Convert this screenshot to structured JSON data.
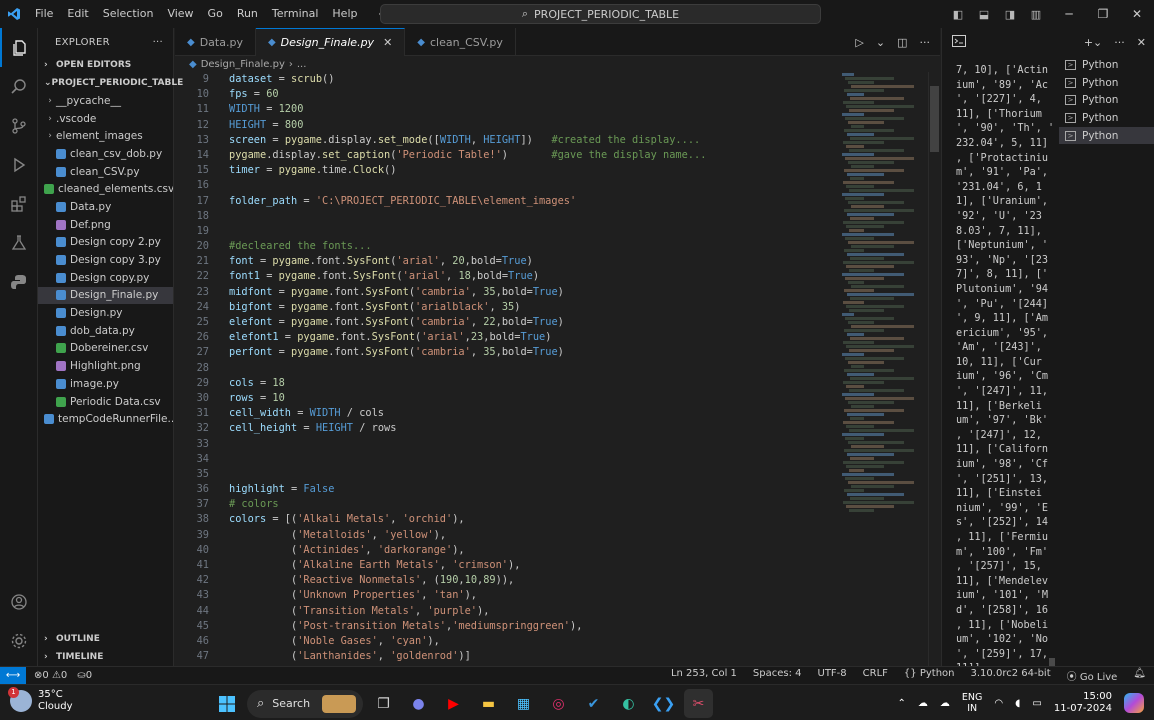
{
  "titlebar": {
    "menu": [
      "File",
      "Edit",
      "Selection",
      "View",
      "Go",
      "Run",
      "Terminal",
      "Help"
    ],
    "search": "PROJECT_PERIODIC_TABLE"
  },
  "sidebar": {
    "title": "EXPLORER",
    "open_editors": "OPEN EDITORS",
    "project": "PROJECT_PERIODIC_TABLE",
    "items": [
      {
        "label": "__pycache__",
        "kind": "folder"
      },
      {
        "label": ".vscode",
        "kind": "folder"
      },
      {
        "label": "element_images",
        "kind": "folder"
      },
      {
        "label": "clean_csv_dob.py",
        "kind": "py"
      },
      {
        "label": "clean_CSV.py",
        "kind": "py"
      },
      {
        "label": "cleaned_elements.csv",
        "kind": "csv"
      },
      {
        "label": "Data.py",
        "kind": "py"
      },
      {
        "label": "Def.png",
        "kind": "png"
      },
      {
        "label": "Design copy 2.py",
        "kind": "py"
      },
      {
        "label": "Design copy 3.py",
        "kind": "py"
      },
      {
        "label": "Design copy.py",
        "kind": "py"
      },
      {
        "label": "Design_Finale.py",
        "kind": "py",
        "selected": true
      },
      {
        "label": "Design.py",
        "kind": "py"
      },
      {
        "label": "dob_data.py",
        "kind": "py"
      },
      {
        "label": "Dobereiner.csv",
        "kind": "csv"
      },
      {
        "label": "Highlight.png",
        "kind": "png"
      },
      {
        "label": "image.py",
        "kind": "py"
      },
      {
        "label": "Periodic Data.csv",
        "kind": "csv"
      },
      {
        "label": "tempCodeRunnerFile....",
        "kind": "py"
      }
    ],
    "outline": "OUTLINE",
    "timeline": "TIMELINE"
  },
  "tabs": [
    {
      "label": "Data.py"
    },
    {
      "label": "Design_Finale.py",
      "active": true
    },
    {
      "label": "clean_CSV.py"
    }
  ],
  "breadcrumb": {
    "file": "Design_Finale.py",
    "rest": "..."
  },
  "code_lines": [
    {
      "n": "9",
      "text": "dataset = scrub()"
    },
    {
      "n": "10",
      "text": "fps = 60"
    },
    {
      "n": "11",
      "text": "WIDTH = 1200"
    },
    {
      "n": "12",
      "text": "HEIGHT = 800"
    },
    {
      "n": "13",
      "text": "screen = pygame.display.set_mode([WIDTH, HEIGHT])   #created the display...."
    },
    {
      "n": "14",
      "text": "pygame.display.set_caption('Periodic Table!')       #gave the display name..."
    },
    {
      "n": "15",
      "text": "timer = pygame.time.Clock()"
    },
    {
      "n": "16",
      "text": ""
    },
    {
      "n": "17",
      "text": "folder_path = 'C:\\PROJECT_PERIODIC_TABLE\\element_images'"
    },
    {
      "n": "18",
      "text": ""
    },
    {
      "n": "19",
      "text": ""
    },
    {
      "n": "20",
      "text": "#decleared the fonts..."
    },
    {
      "n": "21",
      "text": "font = pygame.font.SysFont('arial', 20,bold=True)"
    },
    {
      "n": "22",
      "text": "font1 = pygame.font.SysFont('arial', 18,bold=True)"
    },
    {
      "n": "23",
      "text": "midfont = pygame.font.SysFont('cambria', 35,bold=True)"
    },
    {
      "n": "24",
      "text": "bigfont = pygame.font.SysFont('arialblack', 35)"
    },
    {
      "n": "25",
      "text": "elefont = pygame.font.SysFont('cambria', 22,bold=True)"
    },
    {
      "n": "26",
      "text": "elefont1 = pygame.font.SysFont('arial',23,bold=True)"
    },
    {
      "n": "27",
      "text": "perfont = pygame.font.SysFont('cambria', 35,bold=True)"
    },
    {
      "n": "28",
      "text": ""
    },
    {
      "n": "29",
      "text": "cols = 18"
    },
    {
      "n": "30",
      "text": "rows = 10"
    },
    {
      "n": "31",
      "text": "cell_width = WIDTH / cols"
    },
    {
      "n": "32",
      "text": "cell_height = HEIGHT / rows"
    },
    {
      "n": "33",
      "text": ""
    },
    {
      "n": "34",
      "text": ""
    },
    {
      "n": "35",
      "text": ""
    },
    {
      "n": "36",
      "text": "highlight = False"
    },
    {
      "n": "37",
      "text": "# colors"
    },
    {
      "n": "38",
      "text": "colors = [('Alkali Metals', 'orchid'),"
    },
    {
      "n": "39",
      "text": "          ('Metalloids', 'yellow'),"
    },
    {
      "n": "40",
      "text": "          ('Actinides', 'darkorange'),"
    },
    {
      "n": "41",
      "text": "          ('Alkaline Earth Metals', 'crimson'),"
    },
    {
      "n": "42",
      "text": "          ('Reactive Nonmetals', (190,10,89)),"
    },
    {
      "n": "43",
      "text": "          ('Unknown Properties', 'tan'),"
    },
    {
      "n": "44",
      "text": "          ('Transition Metals', 'purple'),"
    },
    {
      "n": "45",
      "text": "          ('Post-transition Metals','mediumspringgreen'),"
    },
    {
      "n": "46",
      "text": "          ('Noble Gases', 'cyan'),"
    },
    {
      "n": "47",
      "text": "          ('Lanthanides', 'goldenrod')]"
    }
  ],
  "terminal": {
    "output": "7, 10], ['Actin\nium', '89', 'Ac\n', '[227]', 4,\n11], ['Thorium\n', '90', 'Th', '\n232.04', 5, 11]\n, ['Protactiniu\nm', '91', 'Pa',\n'231.04', 6, 1\n1], ['Uranium',\n'92', 'U', '23\n8.03', 7, 11],\n['Neptunium', '\n93', 'Np', '[23\n7]', 8, 11], ['\nPlutonium', '94\n', 'Pu', '[244]\n', 9, 11], ['Am\nericium', '95',\n'Am', '[243]',\n10, 11], ['Cur\nium', '96', 'Cm\n', '[247]', 11,\n11], ['Berkeli\num', '97', 'Bk'\n, '[247]', 12,\n11], ['Californ\nium', '98', 'Cf\n', '[251]', 13,\n11], ['Einstei\nnium', '99', 'E\ns', '[252]', 14\n, 11], ['Fermiu\nm', '100', 'Fm'\n, '[257]', 15,\n11], ['Mendelev\nium', '101', 'M\nd', '[258]', 16\n, 11], ['Nobeli\num', '102', 'No\n', '[259]', 17,\n11]]\nPS C:\\PROJECT_P\nERIODIC_TABLE>",
    "sessions": [
      "Python",
      "Python",
      "Python",
      "Python",
      "Python"
    ]
  },
  "statusbar": {
    "errors": "0",
    "warnings": "0",
    "ports": "0",
    "position": "Ln 253, Col 1",
    "spaces": "Spaces: 4",
    "encoding": "UTF-8",
    "eol": "CRLF",
    "language": "Python",
    "interpreter": "3.10.0rc2 64-bit",
    "golive": "Go Live"
  },
  "taskbar": {
    "temperature": "35°C",
    "condition": "Cloudy",
    "weather_badge": "1",
    "search": "Search",
    "lang1": "ENG",
    "lang2": "IN",
    "time": "15:00",
    "date": "11-07-2024"
  }
}
